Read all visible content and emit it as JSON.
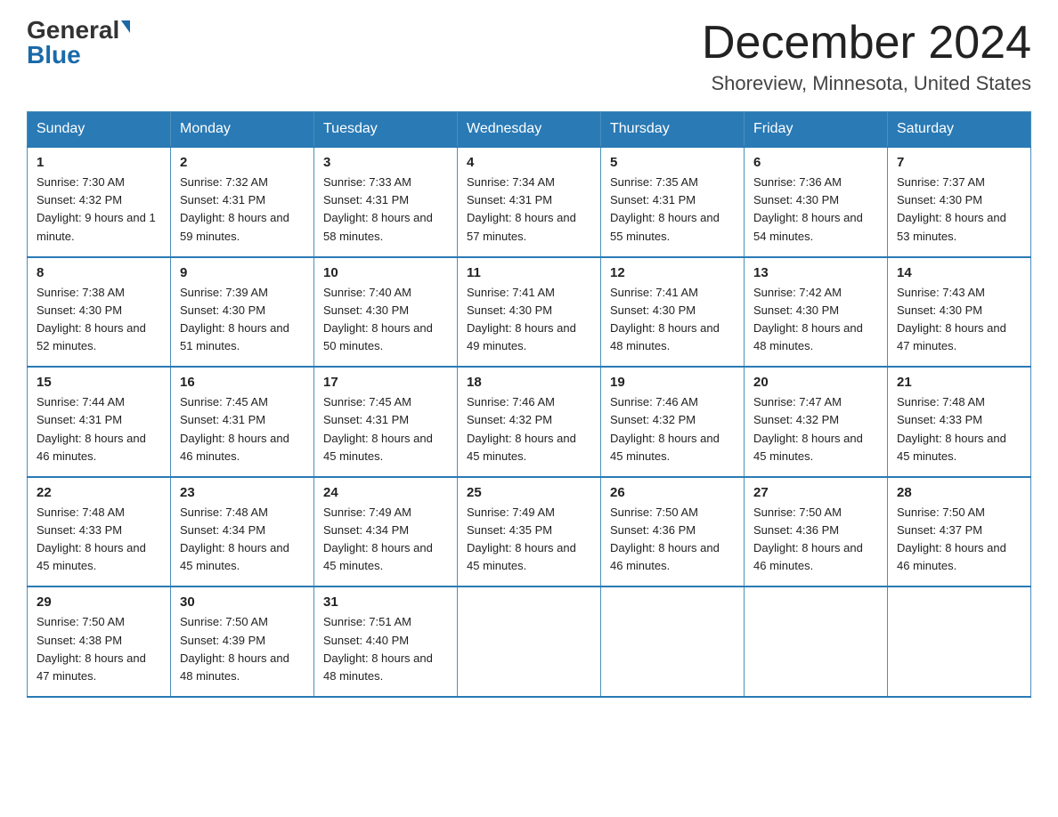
{
  "logo": {
    "general": "General",
    "blue": "Blue"
  },
  "title": {
    "month_year": "December 2024",
    "location": "Shoreview, Minnesota, United States"
  },
  "days_of_week": [
    "Sunday",
    "Monday",
    "Tuesday",
    "Wednesday",
    "Thursday",
    "Friday",
    "Saturday"
  ],
  "weeks": [
    [
      {
        "num": "1",
        "sunrise": "7:30 AM",
        "sunset": "4:32 PM",
        "daylight": "9 hours and 1 minute."
      },
      {
        "num": "2",
        "sunrise": "7:32 AM",
        "sunset": "4:31 PM",
        "daylight": "8 hours and 59 minutes."
      },
      {
        "num": "3",
        "sunrise": "7:33 AM",
        "sunset": "4:31 PM",
        "daylight": "8 hours and 58 minutes."
      },
      {
        "num": "4",
        "sunrise": "7:34 AM",
        "sunset": "4:31 PM",
        "daylight": "8 hours and 57 minutes."
      },
      {
        "num": "5",
        "sunrise": "7:35 AM",
        "sunset": "4:31 PM",
        "daylight": "8 hours and 55 minutes."
      },
      {
        "num": "6",
        "sunrise": "7:36 AM",
        "sunset": "4:30 PM",
        "daylight": "8 hours and 54 minutes."
      },
      {
        "num": "7",
        "sunrise": "7:37 AM",
        "sunset": "4:30 PM",
        "daylight": "8 hours and 53 minutes."
      }
    ],
    [
      {
        "num": "8",
        "sunrise": "7:38 AM",
        "sunset": "4:30 PM",
        "daylight": "8 hours and 52 minutes."
      },
      {
        "num": "9",
        "sunrise": "7:39 AM",
        "sunset": "4:30 PM",
        "daylight": "8 hours and 51 minutes."
      },
      {
        "num": "10",
        "sunrise": "7:40 AM",
        "sunset": "4:30 PM",
        "daylight": "8 hours and 50 minutes."
      },
      {
        "num": "11",
        "sunrise": "7:41 AM",
        "sunset": "4:30 PM",
        "daylight": "8 hours and 49 minutes."
      },
      {
        "num": "12",
        "sunrise": "7:41 AM",
        "sunset": "4:30 PM",
        "daylight": "8 hours and 48 minutes."
      },
      {
        "num": "13",
        "sunrise": "7:42 AM",
        "sunset": "4:30 PM",
        "daylight": "8 hours and 48 minutes."
      },
      {
        "num": "14",
        "sunrise": "7:43 AM",
        "sunset": "4:30 PM",
        "daylight": "8 hours and 47 minutes."
      }
    ],
    [
      {
        "num": "15",
        "sunrise": "7:44 AM",
        "sunset": "4:31 PM",
        "daylight": "8 hours and 46 minutes."
      },
      {
        "num": "16",
        "sunrise": "7:45 AM",
        "sunset": "4:31 PM",
        "daylight": "8 hours and 46 minutes."
      },
      {
        "num": "17",
        "sunrise": "7:45 AM",
        "sunset": "4:31 PM",
        "daylight": "8 hours and 45 minutes."
      },
      {
        "num": "18",
        "sunrise": "7:46 AM",
        "sunset": "4:32 PM",
        "daylight": "8 hours and 45 minutes."
      },
      {
        "num": "19",
        "sunrise": "7:46 AM",
        "sunset": "4:32 PM",
        "daylight": "8 hours and 45 minutes."
      },
      {
        "num": "20",
        "sunrise": "7:47 AM",
        "sunset": "4:32 PM",
        "daylight": "8 hours and 45 minutes."
      },
      {
        "num": "21",
        "sunrise": "7:48 AM",
        "sunset": "4:33 PM",
        "daylight": "8 hours and 45 minutes."
      }
    ],
    [
      {
        "num": "22",
        "sunrise": "7:48 AM",
        "sunset": "4:33 PM",
        "daylight": "8 hours and 45 minutes."
      },
      {
        "num": "23",
        "sunrise": "7:48 AM",
        "sunset": "4:34 PM",
        "daylight": "8 hours and 45 minutes."
      },
      {
        "num": "24",
        "sunrise": "7:49 AM",
        "sunset": "4:34 PM",
        "daylight": "8 hours and 45 minutes."
      },
      {
        "num": "25",
        "sunrise": "7:49 AM",
        "sunset": "4:35 PM",
        "daylight": "8 hours and 45 minutes."
      },
      {
        "num": "26",
        "sunrise": "7:50 AM",
        "sunset": "4:36 PM",
        "daylight": "8 hours and 46 minutes."
      },
      {
        "num": "27",
        "sunrise": "7:50 AM",
        "sunset": "4:36 PM",
        "daylight": "8 hours and 46 minutes."
      },
      {
        "num": "28",
        "sunrise": "7:50 AM",
        "sunset": "4:37 PM",
        "daylight": "8 hours and 46 minutes."
      }
    ],
    [
      {
        "num": "29",
        "sunrise": "7:50 AM",
        "sunset": "4:38 PM",
        "daylight": "8 hours and 47 minutes."
      },
      {
        "num": "30",
        "sunrise": "7:50 AM",
        "sunset": "4:39 PM",
        "daylight": "8 hours and 48 minutes."
      },
      {
        "num": "31",
        "sunrise": "7:51 AM",
        "sunset": "4:40 PM",
        "daylight": "8 hours and 48 minutes."
      },
      null,
      null,
      null,
      null
    ]
  ]
}
